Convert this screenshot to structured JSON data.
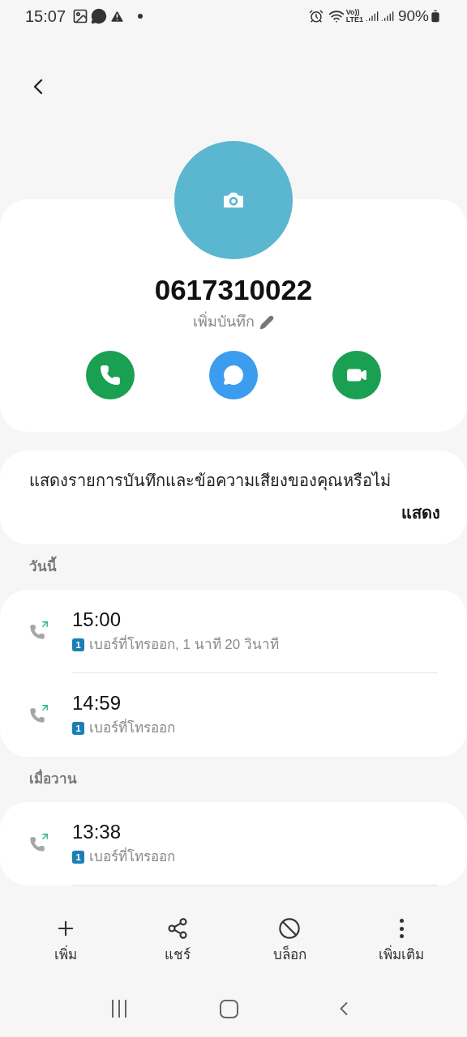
{
  "status_bar": {
    "time": "15:07",
    "volte": "Vo))",
    "network": "LTE1",
    "battery": "90%"
  },
  "contact": {
    "number": "0617310022",
    "note_action": "เพิ่มบันทึก"
  },
  "actions": [
    {
      "kind": "call"
    },
    {
      "kind": "message"
    },
    {
      "kind": "video"
    }
  ],
  "voicemail_prompt": {
    "text": "แสดงรายการบันทึกและข้อความเสียงของคุณหรือไม่",
    "action": "แสดง"
  },
  "call_groups": [
    {
      "heading": "วันนี้",
      "calls": [
        {
          "time": "15:00",
          "sim": "1",
          "detail": "เบอร์ที่โทรออก, 1 นาที 20 วินาที"
        },
        {
          "time": "14:59",
          "sim": "1",
          "detail": "เบอร์ที่โทรออก"
        }
      ]
    },
    {
      "heading": "เมื่อวาน",
      "calls": [
        {
          "time": "13:38",
          "sim": "1",
          "detail": "เบอร์ที่โทรออก"
        }
      ]
    }
  ],
  "toolbar": [
    {
      "kind": "add",
      "label": "เพิ่ม"
    },
    {
      "kind": "share",
      "label": "แชร์"
    },
    {
      "kind": "block",
      "label": "บล็อก"
    },
    {
      "kind": "more",
      "label": "เพิ่มเติม"
    }
  ]
}
